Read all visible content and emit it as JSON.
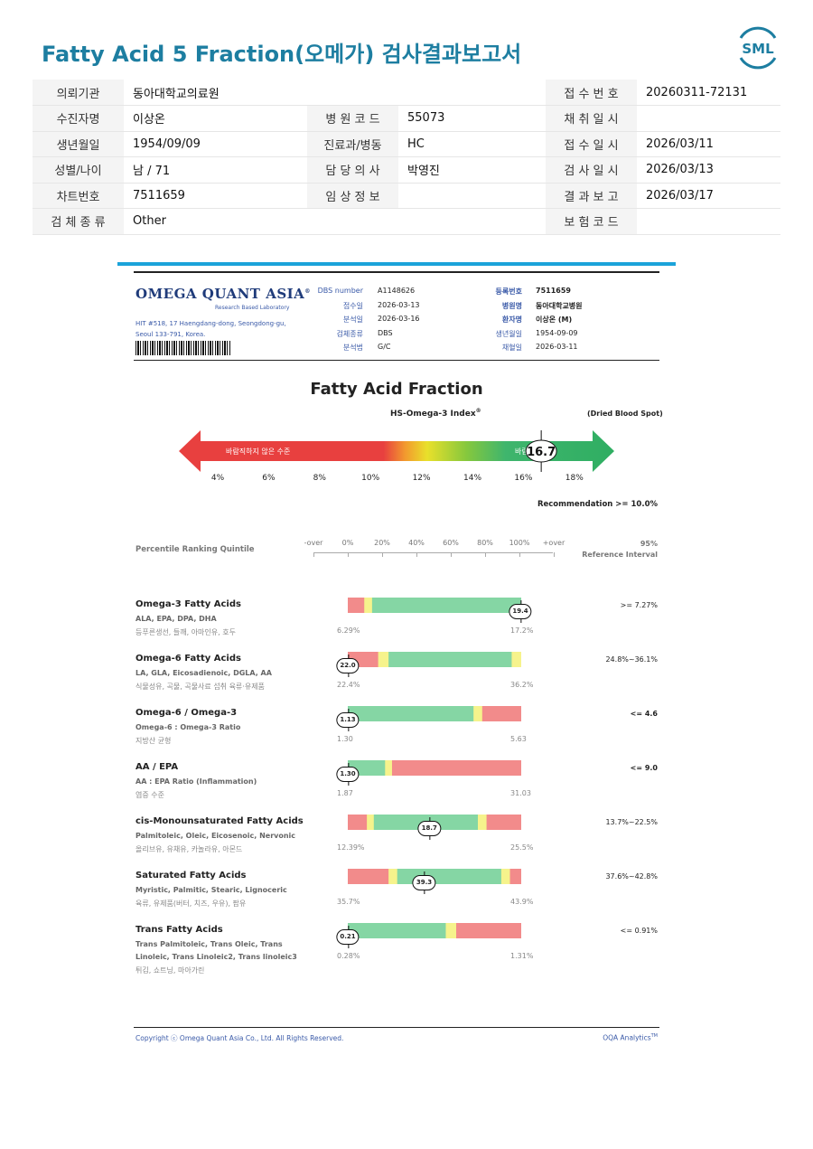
{
  "header": {
    "title": "Fatty Acid 5 Fraction(오메가) 검사결과보고서",
    "logo_text": "SML",
    "brand_color": "#1d7ea1"
  },
  "patient_info": {
    "rows": [
      [
        {
          "label": "의뢰기관",
          "value": "동아대학교의료원"
        },
        {
          "label": "",
          "value": ""
        },
        {
          "label": "접 수 번 호",
          "value": "20260311-72131"
        }
      ],
      [
        {
          "label": "수진자명",
          "value": "이상온"
        },
        {
          "label": "병 원 코 드",
          "value": "55073"
        },
        {
          "label": "채 취 일 시",
          "value": ""
        }
      ],
      [
        {
          "label": "생년월일",
          "value": "1954/09/09"
        },
        {
          "label": "진료과/병동",
          "value": "HC"
        },
        {
          "label": "접 수 일 시",
          "value": "2026/03/11"
        }
      ],
      [
        {
          "label": "성별/나이",
          "value": "남 / 71"
        },
        {
          "label": "담 당 의 사",
          "value": "박영진"
        },
        {
          "label": "검 사 일 시",
          "value": "2026/03/13"
        }
      ],
      [
        {
          "label": "차트번호",
          "value": "7511659"
        },
        {
          "label": "임 상 정 보",
          "value": ""
        },
        {
          "label": "결 과 보 고",
          "value": "2026/03/17"
        }
      ],
      [
        {
          "label": "검 체 종 류",
          "value": "Other"
        },
        {
          "label": "",
          "value": ""
        },
        {
          "label": "보 험 코 드",
          "value": ""
        }
      ]
    ]
  },
  "report": {
    "lab_name": "OMEGA QUANT ASIA",
    "lab_mark": "®",
    "lab_subtitle": "Research Based Laboratory",
    "lab_address": "HIT #518, 17 Haengdang-dong, Seongdong-gu, Seoul 133-791, Korea.",
    "meta_left": [
      {
        "k": "DBS number",
        "v": "A1148626"
      },
      {
        "k": "접수일",
        "v": "2026-03-13"
      },
      {
        "k": "분석일",
        "v": "2026-03-16"
      },
      {
        "k": "검체종류",
        "v": "DBS"
      },
      {
        "k": "분석법",
        "v": "G/C"
      }
    ],
    "meta_right": [
      {
        "k": "등록번호",
        "v": "7511659",
        "bold": true
      },
      {
        "k": "병원명",
        "v": "동아대학교병원",
        "bold": true
      },
      {
        "k": "환자명",
        "v": "이상온 (M)",
        "bold": true
      },
      {
        "k": "생년월일",
        "v": "1954-09-09",
        "bold": false
      },
      {
        "k": "채혈일",
        "v": "2026-03-11",
        "bold": false
      }
    ],
    "section_title": "Fatty Acid Fraction",
    "index_title": "HS-Omega-3 Index",
    "index_mark": "®",
    "sample_type": "(Dried Blood Spot)",
    "arrow_left_label": "바람직하지 않은 수준",
    "arrow_right_label": "바람직한 수준",
    "index_value": "16.7",
    "index_number": 16.7,
    "ticks": [
      "4%",
      "6%",
      "8%",
      "10%",
      "12%",
      "14%",
      "16%",
      "18%"
    ],
    "recommendation": "Recommendation  >= 10.0%",
    "quintile_label": "Percentile Ranking Quintile",
    "scale_labels": [
      "-over",
      "0%",
      "20%",
      "40%",
      "60%",
      "80%",
      "100%",
      "+over"
    ],
    "ref_header_1": "95%",
    "ref_header_2": "Reference Interval",
    "colors": {
      "red": "#f28b8b",
      "yellow": "#f6f38c",
      "green": "#85d6a4"
    },
    "rows": [
      {
        "name": "Omega-3 Fatty Acids",
        "sub": [
          "ALA, EPA, DPA, DHA"
        ],
        "kr": "등푸른생선, 들깨, 아마인유, 호두",
        "value": "19.4",
        "pos": 0.995,
        "min": "6.29%",
        "max": "17.2%",
        "ref": ">= 7.27%",
        "ref_bold": false,
        "segments": [
          [
            "red",
            0.095
          ],
          [
            "yellow",
            0.045
          ],
          [
            "green",
            0.86
          ]
        ]
      },
      {
        "name": "Omega-6 Fatty Acids",
        "sub": [
          "LA, GLA, Eicosadienoic, DGLA, AA"
        ],
        "kr": "식물성유, 곡물, 곡물사료 섭취 육류·유제품",
        "value": "22.0",
        "pos": 0.0,
        "min": "22.4%",
        "max": "36.2%",
        "ref": "24.8%~36.1%",
        "ref_bold": false,
        "segments": [
          [
            "red",
            0.175
          ],
          [
            "yellow",
            0.06
          ],
          [
            "green",
            0.71
          ],
          [
            "yellow",
            0.055
          ]
        ]
      },
      {
        "name": "Omega-6 / Omega-3",
        "sub": [
          "Omega-6 : Omega-3 Ratio"
        ],
        "kr": "지방산 균형",
        "value": "1.13",
        "pos": 0.0,
        "min": "1.30",
        "max": "5.63",
        "ref": "<= 4.6",
        "ref_bold": true,
        "segments": [
          [
            "green",
            0.725
          ],
          [
            "yellow",
            0.05
          ],
          [
            "red",
            0.225
          ]
        ]
      },
      {
        "name": "AA / EPA",
        "sub": [
          "AA : EPA Ratio (Inflammation)"
        ],
        "kr": "염증 수준",
        "value": "1.30",
        "pos": 0.0,
        "min": "1.87",
        "max": "31.03",
        "ref": "<= 9.0",
        "ref_bold": true,
        "segments": [
          [
            "green",
            0.215
          ],
          [
            "yellow",
            0.04
          ],
          [
            "red",
            0.745
          ]
        ]
      },
      {
        "name": "cis-Monounsaturated Fatty Acids",
        "sub": [
          "Palmitoleic, Oleic, Eicosenoic, Nervonic"
        ],
        "kr": "올리브유, 유채유, 카놀라유, 아몬드",
        "value": "18.7",
        "pos": 0.47,
        "min": "12.39%",
        "max": "25.5%",
        "ref": "13.7%~22.5%",
        "ref_bold": false,
        "segments": [
          [
            "red",
            0.11
          ],
          [
            "yellow",
            0.04
          ],
          [
            "green",
            0.6
          ],
          [
            "yellow",
            0.05
          ],
          [
            "red",
            0.2
          ]
        ]
      },
      {
        "name": "Saturated Fatty Acids",
        "sub": [
          "Myristic, Palmitic, Stearic, Lignoceric"
        ],
        "kr": "육류, 유제품(버터, 치즈, 우유), 팜유",
        "value": "39.3",
        "pos": 0.44,
        "min": "35.7%",
        "max": "43.9%",
        "ref": "37.6%~42.8%",
        "ref_bold": false,
        "segments": [
          [
            "red",
            0.235
          ],
          [
            "yellow",
            0.05
          ],
          [
            "green",
            0.6
          ],
          [
            "yellow",
            0.05
          ],
          [
            "red",
            0.065
          ]
        ]
      },
      {
        "name": "Trans Fatty Acids",
        "sub": [
          "Trans Palmitoleic, Trans Oleic, Trans",
          "Linoleic, Trans Linoleic2, Trans linoleic3"
        ],
        "kr": "튀김, 쇼트닝, 마아가린",
        "value": "0.21",
        "pos": 0.0,
        "min": "0.28%",
        "max": "1.31%",
        "ref": "<= 0.91%",
        "ref_bold": false,
        "segments": [
          [
            "green",
            0.565
          ],
          [
            "yellow",
            0.06
          ],
          [
            "red",
            0.375
          ]
        ]
      }
    ],
    "copyright": "Copyright ⓒ Omega Quant Asia Co., Ltd.  All Rights Reserved.",
    "analytics": "OQA Analytics",
    "analytics_mark": "TM"
  }
}
